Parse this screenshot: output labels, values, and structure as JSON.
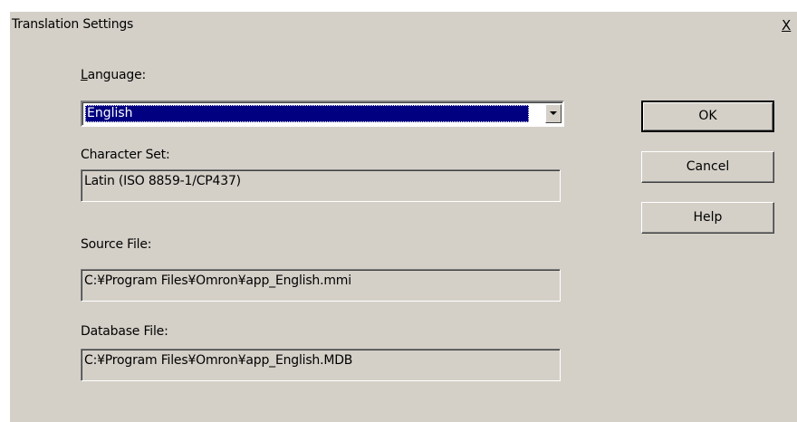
{
  "dialog": {
    "title": "Translation Settings",
    "close_label": "X"
  },
  "language": {
    "label_underlined": "L",
    "label_rest": "anguage:",
    "selected": "English"
  },
  "charset": {
    "label": "Character Set:",
    "value": "Latin (ISO 8859-1/CP437)"
  },
  "source": {
    "label": "Source File:",
    "value": "C:¥Program Files¥Omron¥app_English.mmi"
  },
  "database": {
    "label": "Database File:",
    "value": "C:¥Program Files¥Omron¥app_English.MDB"
  },
  "buttons": {
    "ok": "OK",
    "cancel": "Cancel",
    "help": "Help"
  },
  "colors": {
    "face": "#d4d0c8",
    "selection": "#000080"
  }
}
